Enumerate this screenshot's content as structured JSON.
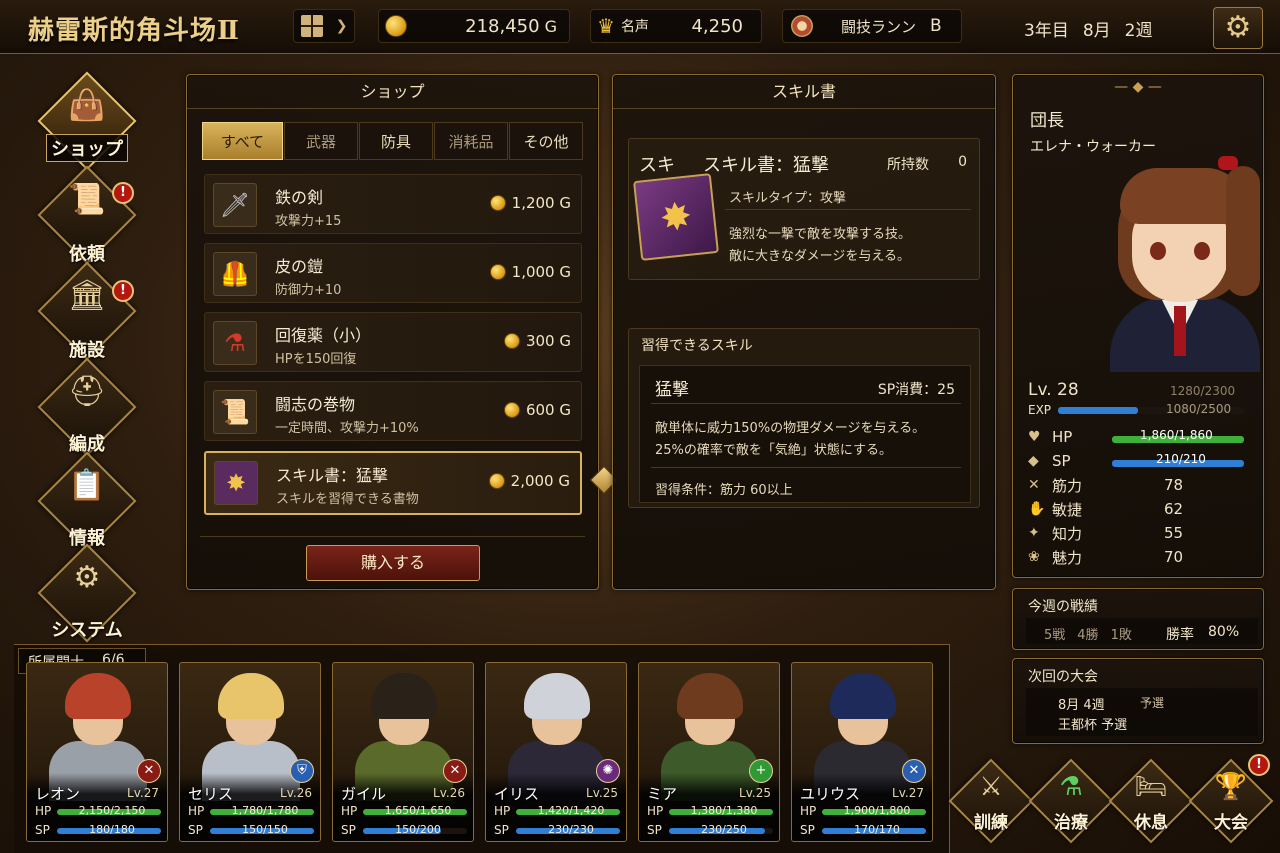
{
  "header": {
    "title": "赫雷斯的角斗场Ⅱ",
    "gold_value": "218,450",
    "gold_unit": "G",
    "fame_label": "名声",
    "fame_value": "4,250",
    "rank_label": "闘技ランン",
    "rank_value": "B",
    "date_year": "3年目",
    "date_month": "8月",
    "date_week": "2週"
  },
  "nav": {
    "shop": "ショップ",
    "quest": "依頼",
    "facility": "施設",
    "formation": "編成",
    "info": "情報",
    "system": "システム",
    "quest_badge": "!",
    "facility_badge": "!"
  },
  "shop": {
    "title": "ショップ",
    "tabs": [
      "すべて",
      "武器",
      "防具",
      "消耗品",
      "その他"
    ],
    "items": [
      {
        "name": "鉄の剣",
        "desc": "攻撃力+15",
        "price": "1,200 G",
        "icon": "sword-icon"
      },
      {
        "name": "皮の鎧",
        "desc": "防御力+10",
        "price": "1,000 G",
        "icon": "armor-icon"
      },
      {
        "name": "回復薬（小）",
        "desc": "HPを150回復",
        "price": "300 G",
        "icon": "potion-icon"
      },
      {
        "name": "闘志の巻物",
        "desc": "一定時間、攻撃力+10%",
        "price": "600 G",
        "icon": "scroll-icon"
      },
      {
        "name": "スキル書：猛撃",
        "desc": "スキルを習得できる書物",
        "price": "2,000 G",
        "icon": "skill-book-icon"
      }
    ],
    "buy_button": "購入する"
  },
  "skillbook": {
    "title": "スキル書",
    "name": "スキル書：猛撃",
    "name_prefix": "スキ",
    "owned_label": "所持数",
    "owned_value": "0",
    "type_line": "スキルタイプ：攻撃",
    "desc1": "強烈な一撃で敵を攻撃する技。",
    "desc2": "敵に大きなダメージを与える。",
    "learnable_header": "習得できるスキル",
    "skill_name": "猛撃",
    "sp_cost": "SP消費：25",
    "skill_desc1": "敵単体に威力150%の物理ダメージを与える。",
    "skill_desc2": "25%の確率で敵を「気絶」状態にする。",
    "requirement": "習得条件：筋力 60以上"
  },
  "leader": {
    "role": "団長",
    "name": "エレナ・ウォーカー",
    "level": "Lv. 28",
    "level_exp": "1280/2300",
    "exp_label": "EXP",
    "exp_value": "1080/2500",
    "exp_fill": 0.43,
    "hp_label": "HP",
    "hp_value": "1,860/1,860",
    "hp_fill": 1.0,
    "sp_label": "SP",
    "sp_value": "210/210",
    "sp_fill": 1.0,
    "stats": [
      {
        "label": "筋力",
        "value": "78",
        "icon": "strength-icon"
      },
      {
        "label": "敏捷",
        "value": "62",
        "icon": "agility-icon"
      },
      {
        "label": "知力",
        "value": "55",
        "icon": "intelligence-icon"
      },
      {
        "label": "魅力",
        "value": "70",
        "icon": "charm-icon"
      }
    ]
  },
  "weekly": {
    "title": "今週の戦績",
    "battles": "5戦",
    "wins": "4勝",
    "losses": "1敗",
    "winrate_label": "勝率",
    "winrate_value": "80%"
  },
  "next_tournament": {
    "title": "次回の大会",
    "date": "8月 4週",
    "round_tag": "予選",
    "name": "王都杯 予選"
  },
  "roster": {
    "label": "所属闘士",
    "count": "6/6",
    "members": [
      {
        "name": "レオン",
        "level": "Lv.27",
        "hp": "2,150/2,150",
        "sp": "180/180",
        "hp_fill": 1.0,
        "sp_fill": 1.0,
        "class_icon": "sword-class-icon"
      },
      {
        "name": "セリス",
        "level": "Lv.26",
        "hp": "1,780/1,780",
        "sp": "150/150",
        "hp_fill": 1.0,
        "sp_fill": 1.0,
        "class_icon": "shield-class-icon"
      },
      {
        "name": "ガイル",
        "level": "Lv.26",
        "hp": "1,650/1,650",
        "sp": "150/200",
        "hp_fill": 1.0,
        "sp_fill": 0.75,
        "class_icon": "sword-class-icon"
      },
      {
        "name": "イリス",
        "level": "Lv.25",
        "hp": "1,420/1,420",
        "sp": "230/230",
        "hp_fill": 1.0,
        "sp_fill": 1.0,
        "class_icon": "magic-class-icon"
      },
      {
        "name": "ミア",
        "level": "Lv.25",
        "hp": "1,380/1,380",
        "sp": "230/250",
        "hp_fill": 1.0,
        "sp_fill": 0.92,
        "class_icon": "healer-class-icon"
      },
      {
        "name": "ユリウス",
        "level": "Lv.27",
        "hp": "1,900/1,800",
        "sp": "170/170",
        "hp_fill": 1.0,
        "sp_fill": 1.0,
        "class_icon": "dual-blade-class-icon"
      }
    ]
  },
  "actions": {
    "train": "訓練",
    "heal": "治療",
    "rest": "休息",
    "tournament": "大会",
    "tournament_badge": "!"
  },
  "colors": {
    "accent_gold": "#e9c777",
    "hp_green": "#3fb13a",
    "sp_blue": "#2f7fd6",
    "alert_red": "#b3170f"
  }
}
